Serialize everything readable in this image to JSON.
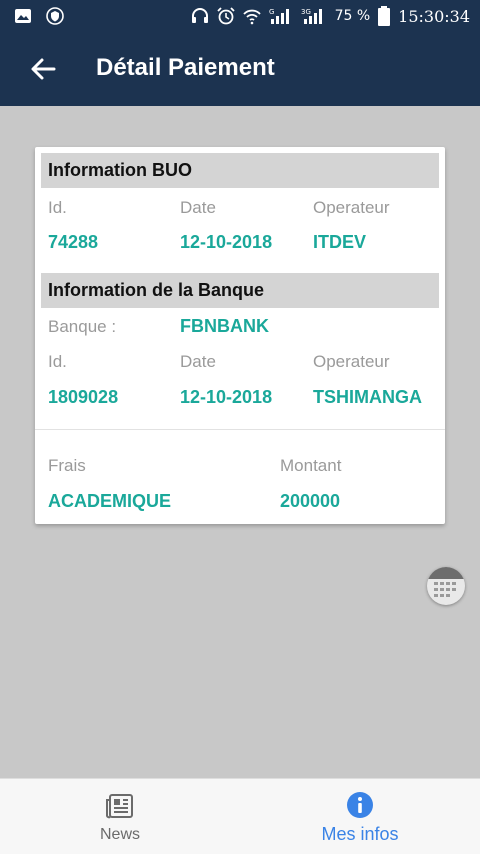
{
  "status_bar": {
    "battery_pct": "75 %",
    "time": "15:30:34"
  },
  "app_bar": {
    "title": "Détail Paiement"
  },
  "buo": {
    "heading": "Information BUO",
    "id_label": "Id.",
    "date_label": "Date",
    "operator_label": "Operateur",
    "id": "74288",
    "date": "12-10-2018",
    "operator": "ITDEV"
  },
  "bank": {
    "heading": "Information de la Banque",
    "bank_label": "Banque :",
    "bank_name": "FBNBANK",
    "id_label": "Id.",
    "date_label": "Date",
    "operator_label": "Operateur",
    "id": "1809028",
    "date": "12-10-2018",
    "operator": "TSHIMANGA"
  },
  "payment": {
    "fees_label": "Frais",
    "amount_label": "Montant",
    "fees": "ACADEMIQUE",
    "amount": "200000"
  },
  "bottom_nav": {
    "items": [
      {
        "label": "News",
        "icon": "newspaper-icon",
        "active": false
      },
      {
        "label": "Mes infos",
        "icon": "info-icon",
        "active": true
      }
    ]
  },
  "colors": {
    "app_bar": "#1c3350",
    "accent_value": "#1aa89a",
    "active_nav": "#3a83e6",
    "background": "#c8c8c8"
  }
}
